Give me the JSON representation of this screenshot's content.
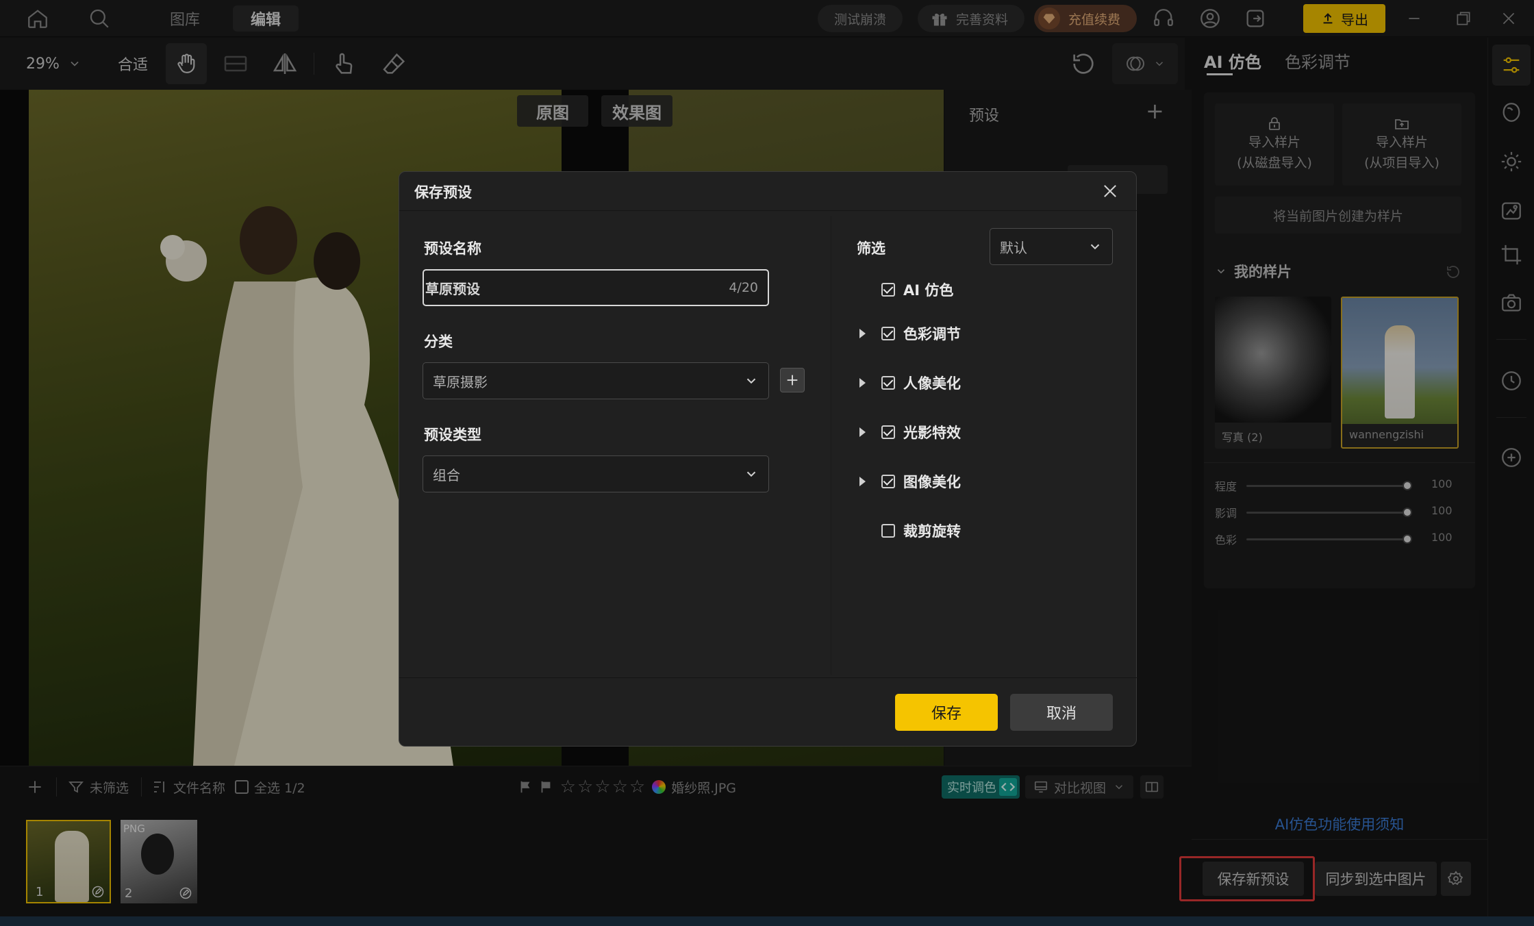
{
  "titlebar": {
    "tabs": [
      {
        "label": "图库"
      },
      {
        "label": "编辑"
      }
    ],
    "pills": {
      "crash_test": "测试崩溃",
      "complete_profile": "完善资料",
      "recharge": "充值续费"
    },
    "export_label": "导出"
  },
  "toolbar": {
    "zoom": "29%",
    "fit": "合适"
  },
  "canvas": {
    "original_label": "原图",
    "effect_label": "效果图"
  },
  "preset_column": {
    "title": "预设",
    "add_symbol": "+"
  },
  "dialog": {
    "title": "保存预设",
    "name_label": "预设名称",
    "name_value": "草原预设",
    "name_counter": "4/20",
    "category_label": "分类",
    "category_value": "草原摄影",
    "type_label": "预设类型",
    "type_value": "组合",
    "filter_label": "筛选",
    "filter_value": "默认",
    "options": [
      {
        "label": "AI 仿色",
        "checked": true,
        "expandable": false
      },
      {
        "label": "色彩调节",
        "checked": true,
        "expandable": true
      },
      {
        "label": "人像美化",
        "checked": true,
        "expandable": true
      },
      {
        "label": "光影特效",
        "checked": true,
        "expandable": true
      },
      {
        "label": "图像美化",
        "checked": true,
        "expandable": true
      },
      {
        "label": "裁剪旋转",
        "checked": false,
        "expandable": false
      }
    ],
    "save_button": "保存",
    "cancel_button": "取消"
  },
  "filmbar": {
    "filter": "未筛选",
    "sort": "文件名称",
    "select_all": "全选 1/2",
    "filename": "婚纱照.JPG",
    "realtime": "实时调色",
    "compare_view": "对比视图",
    "thumbs": [
      {
        "index": "1"
      },
      {
        "index": "2",
        "badge": "PNG"
      }
    ]
  },
  "rightpanel": {
    "tabs": [
      {
        "label": "AI 仿色"
      },
      {
        "label": "色彩调节"
      }
    ],
    "import_disk": [
      "导入样片",
      "(从磁盘导入)"
    ],
    "import_project": [
      "导入样片",
      "(从项目导入)"
    ],
    "create_from_current": "将当前图片创建为样片",
    "my_samples_title": "我的样片",
    "samples": [
      {
        "caption": "写真 (2)"
      },
      {
        "caption": "wannengzishi"
      }
    ],
    "sliders": [
      {
        "label": "程度",
        "value": 100
      },
      {
        "label": "影调",
        "value": 100
      },
      {
        "label": "色彩",
        "value": 100
      }
    ],
    "help_link": "AI仿色功能使用须知",
    "save_new_preset": "保存新预设",
    "sync_selected": "同步到选中图片"
  },
  "colors": {
    "accent_yellow": "#f5c400",
    "highlight_red": "#e03a3a",
    "link_blue": "#3a7bd5",
    "teal": "#12a89a"
  }
}
